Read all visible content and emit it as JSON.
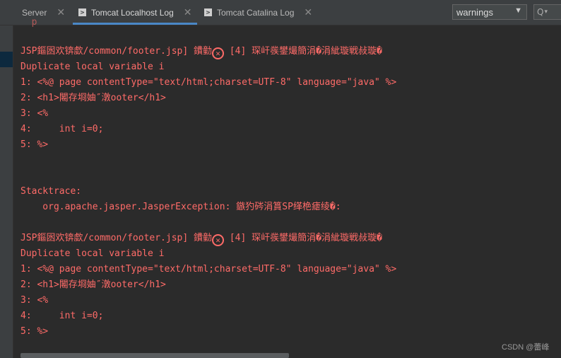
{
  "tabs": [
    {
      "label": "Server",
      "icon": "",
      "active": false
    },
    {
      "label": "Tomcat Localhost Log",
      "icon": "console-icon",
      "active": true
    },
    {
      "label": "Tomcat Catalina Log",
      "icon": "console-icon",
      "active": false
    }
  ],
  "close_glyph": "✕",
  "filter": {
    "value": "warnings",
    "arrow": "▼"
  },
  "search": {
    "glyph": "Q",
    "dropdown": "▾"
  },
  "colors": {
    "error_text": "#ff6b68",
    "background": "#2b2b2b",
    "tabbar": "#3c3f41"
  },
  "console": {
    "top_fragment": "  p                                                                                                    pp",
    "block1": {
      "jsp_prefix": "JSP鏂囦欢锛歔/common/footer.jsp] 鐨勭",
      "jsp_suffix": " [4] 琛屽彂鐢熶簡涓�涓紪璇戦敊璇�",
      "err_glyph": "✕",
      "dup": "Duplicate local variable i",
      "code": [
        "1: <%@ page contentType=\"text/html;charset=UTF-8\" language=\"java\" %>",
        "2: <h1>闂存埛妯″潡ooter</h1>",
        "3: <%",
        "4:     int i=0;",
        "5: %>"
      ]
    },
    "stacktrace_label": "Stacktrace:",
    "exception_line": "    org.apache.jasper.JasperException: 鏃犳硶涓篔SP缂栬瘧绫�:",
    "block2": {
      "jsp_prefix": "JSP鏂囦欢锛歔/common/footer.jsp] 鐨勭",
      "jsp_suffix": " [4] 琛屽彂鐢熶簡涓�涓紪璇戦敊璇�",
      "err_glyph": "✕",
      "dup": "Duplicate local variable i",
      "code": [
        "1: <%@ page contentType=\"text/html;charset=UTF-8\" language=\"java\" %>",
        "2: <h1>闂存埛妯″潡ooter</h1>",
        "3: <%",
        "4:     int i=0;",
        "5: %>"
      ]
    }
  },
  "watermark": "CSDN @蕾峰"
}
